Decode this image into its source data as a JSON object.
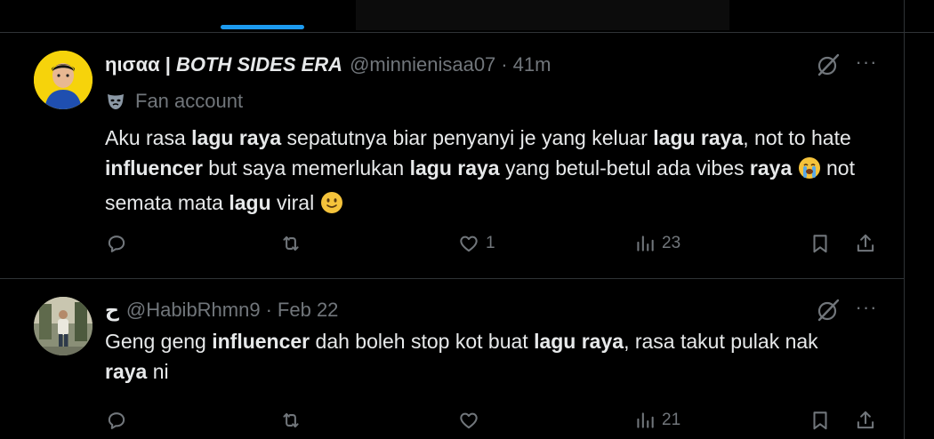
{
  "tweets": [
    {
      "display_name_prefix": "ηισαα |",
      "display_name_italic": "BOTH SIDES ERA",
      "handle": "@minnienisaa07",
      "time": "41m",
      "account_label": "Fan account",
      "text_runs": [
        {
          "t": "Aku rasa "
        },
        {
          "t": "lagu raya",
          "b": true
        },
        {
          "t": " sepatutnya biar penyanyi je yang keluar "
        },
        {
          "t": "lagu raya",
          "b": true
        },
        {
          "t": ", not to hate "
        },
        {
          "t": "influencer",
          "b": true
        },
        {
          "t": " but saya memerlukan "
        },
        {
          "t": "lagu raya",
          "b": true
        },
        {
          "t": " yang betul-betul ada vibes "
        },
        {
          "t": "raya",
          "b": true
        },
        {
          "t": " "
        },
        {
          "emoji": "loudly-crying-face"
        },
        {
          "t": " not semata mata "
        },
        {
          "t": "lagu",
          "b": true
        },
        {
          "t": " viral "
        },
        {
          "emoji": "slightly-smiling-face"
        }
      ],
      "stats": {
        "replies": "",
        "reposts": "",
        "likes": "1",
        "views": "23"
      }
    },
    {
      "display_name_prefix": "ح",
      "display_name_italic": "",
      "handle": "@HabibRhmn9",
      "time": "Feb 22",
      "account_label": "",
      "text_runs": [
        {
          "t": "Geng geng "
        },
        {
          "t": "influencer",
          "b": true
        },
        {
          "t": " dah boleh stop kot buat "
        },
        {
          "t": "lagu raya",
          "b": true
        },
        {
          "t": ", rasa takut pulak nak "
        },
        {
          "t": "raya",
          "b": true
        },
        {
          "t": " ni"
        }
      ],
      "stats": {
        "replies": "",
        "reposts": "",
        "likes": "",
        "views": "21"
      }
    }
  ],
  "separator": "·",
  "more_label": "···",
  "colors": {
    "background": "#000000",
    "text": "#e7e9ea",
    "muted": "#71767b",
    "accent": "#1d9bf0",
    "border": "#2f3336"
  },
  "icons": [
    "comment-icon",
    "repost-icon",
    "like-icon",
    "views-icon",
    "bookmark-icon",
    "share-icon",
    "grok-icon",
    "more-icon",
    "mask-icon"
  ]
}
